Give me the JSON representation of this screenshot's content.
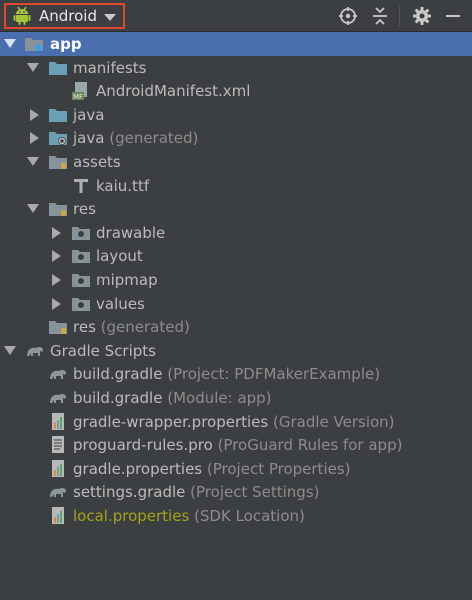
{
  "toolbar": {
    "view_mode": "Android"
  },
  "tree": [
    {
      "name": "app",
      "hint": ""
    },
    {
      "name": "manifests",
      "hint": ""
    },
    {
      "name": "AndroidManifest.xml",
      "hint": ""
    },
    {
      "name": "java",
      "hint": ""
    },
    {
      "name": "java",
      "hint": "(generated)"
    },
    {
      "name": "assets",
      "hint": ""
    },
    {
      "name": "kaiu.ttf",
      "hint": ""
    },
    {
      "name": "res",
      "hint": ""
    },
    {
      "name": "drawable",
      "hint": ""
    },
    {
      "name": "layout",
      "hint": ""
    },
    {
      "name": "mipmap",
      "hint": ""
    },
    {
      "name": "values",
      "hint": ""
    },
    {
      "name": "res",
      "hint": "(generated)"
    },
    {
      "name": "Gradle Scripts",
      "hint": ""
    },
    {
      "name": "build.gradle",
      "hint": "(Project: PDFMakerExample)"
    },
    {
      "name": "build.gradle",
      "hint": "(Module: app)"
    },
    {
      "name": "gradle-wrapper.properties",
      "hint": "(Gradle Version)"
    },
    {
      "name": "proguard-rules.pro",
      "hint": "(ProGuard Rules for app)"
    },
    {
      "name": "gradle.properties",
      "hint": "(Project Properties)"
    },
    {
      "name": "settings.gradle",
      "hint": "(Project Settings)"
    },
    {
      "name": "local.properties",
      "hint": "(SDK Location)"
    }
  ],
  "icons": [
    "android-icon",
    "target-icon",
    "collapse-all-icon",
    "gear-icon",
    "minimize-icon",
    "module-folder-icon",
    "folder-icon",
    "manifest-file-icon",
    "font-file-icon",
    "gradle-icon",
    "properties-file-icon"
  ],
  "colors": {
    "background": "#3c3f41",
    "selection": "#4b6eaf",
    "highlight_border": "#e1472f",
    "folder": "#6a9fb5",
    "hint_text": "#8c8c8c",
    "modified_text": "#a3a319"
  }
}
